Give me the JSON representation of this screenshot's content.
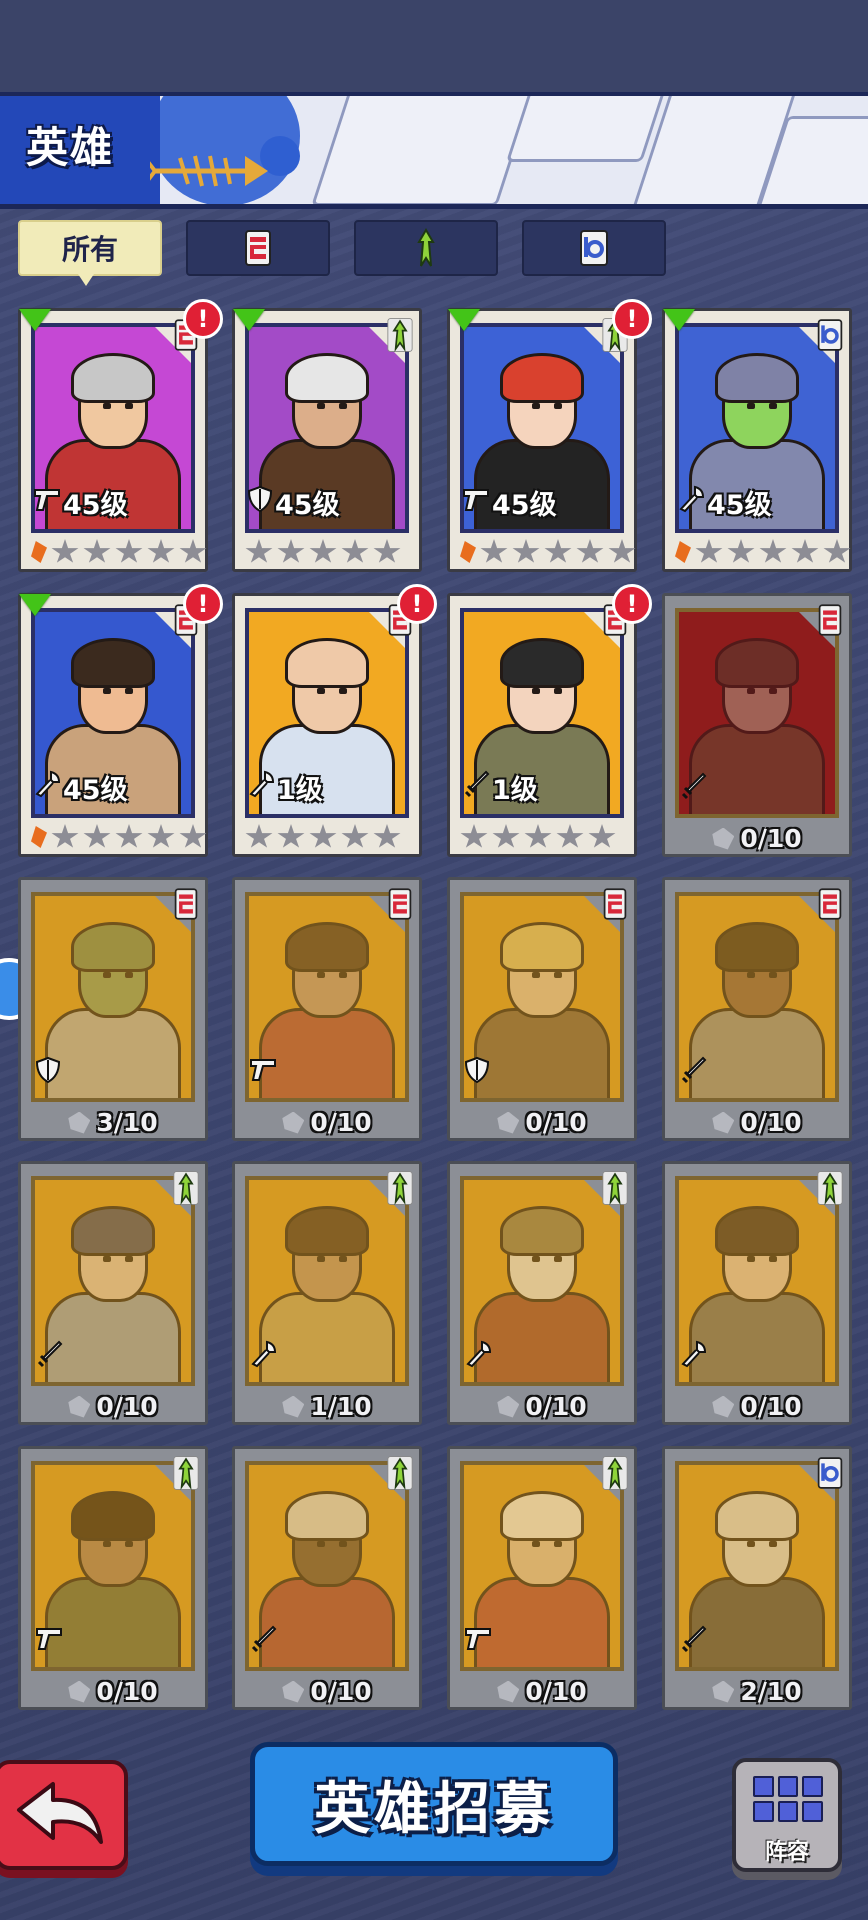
{
  "header": {
    "title": "英雄"
  },
  "tabs": [
    {
      "label": "所有",
      "icon": "all",
      "active": true
    },
    {
      "label": "",
      "icon": "tank-class-icon",
      "active": false
    },
    {
      "label": "",
      "icon": "agility-class-icon",
      "active": false
    },
    {
      "label": "",
      "icon": "tech-class-icon",
      "active": false
    }
  ],
  "colors": {
    "green_indicator": "#43c418",
    "alert": "#e02035",
    "accent_blue": "#2a8ce6",
    "back_red": "#e23245"
  },
  "heroes": [
    {
      "owned": true,
      "bg": "#c548d4",
      "class": "red",
      "role": "gun",
      "level": "45级",
      "new": true,
      "alert": true,
      "frag": true,
      "skin": "#f0c8a0",
      "hair": "#c7c7c7",
      "outfit": "#c03534"
    },
    {
      "owned": true,
      "bg": "#a34bc7",
      "class": "green",
      "role": "shield",
      "level": "45级",
      "new": true,
      "alert": false,
      "frag": false,
      "skin": "#dcae8a",
      "hair": "#e6e6e6",
      "outfit": "#5a3a24"
    },
    {
      "owned": true,
      "bg": "#3d62d6",
      "class": "green",
      "role": "gun",
      "level": "45级",
      "new": true,
      "alert": true,
      "frag": true,
      "skin": "#f5d4bd",
      "hair": "#d9412e",
      "outfit": "#232323"
    },
    {
      "owned": true,
      "bg": "#3f63d3",
      "class": "blue",
      "role": "wrench",
      "level": "45级",
      "new": true,
      "alert": false,
      "frag": true,
      "skin": "#8ed45d",
      "hair": "#7f82a6",
      "outfit": "#8288ad"
    },
    {
      "owned": true,
      "bg": "#3558cf",
      "class": "red",
      "role": "wrench",
      "level": "45级",
      "new": true,
      "alert": true,
      "frag": true,
      "skin": "#efbb92",
      "hair": "#3b2a1e",
      "outfit": "#c9a27b"
    },
    {
      "owned": true,
      "bg": "#f2a922",
      "class": "red",
      "role": "wrench",
      "level": "1级",
      "new": false,
      "alert": true,
      "frag": false,
      "skin": "#efc9a8",
      "hair": "#efc9a8",
      "outfit": "#d7e1ef"
    },
    {
      "owned": true,
      "bg": "#f2a922",
      "class": "red",
      "role": "sword",
      "level": "1级",
      "new": false,
      "alert": true,
      "frag": false,
      "skin": "#f3d4be",
      "hair": "#2a2a2a",
      "outfit": "#7a7a55"
    },
    {
      "owned": false,
      "bg": "#8f1c1c",
      "class": "red",
      "role": "sword",
      "shards": "0/10",
      "skin": "#b59a79",
      "hair": "#5a3d2a",
      "outfit": "#6e4a2a"
    },
    {
      "owned": false,
      "bg": "#d69a22",
      "class": "red",
      "role": "shield",
      "shards": "3/10",
      "skin": "#7da055",
      "hair": "#6b8c48",
      "outfit": "#b0b0b0"
    },
    {
      "owned": false,
      "bg": "#d69a22",
      "class": "red",
      "role": "gun",
      "shards": "0/10",
      "skin": "#c49473",
      "hair": "#4b3323",
      "outfit": "#c53d37"
    },
    {
      "owned": false,
      "bg": "#d69a22",
      "class": "red",
      "role": "shield",
      "shards": "0/10",
      "skin": "#e9c49a",
      "hair": "#e4c150",
      "outfit": "#7a5a3a"
    },
    {
      "owned": false,
      "bg": "#d69a22",
      "class": "red",
      "role": "sword",
      "shards": "0/10",
      "skin": "#8b5a3a",
      "hair": "#3a2a1a",
      "outfit": "#8c8c8c"
    },
    {
      "owned": false,
      "bg": "#d69a22",
      "class": "green",
      "role": "sword",
      "shards": "0/10",
      "skin": "#e6c6b0",
      "hair": "#404a78",
      "outfit": "#8aa1c4"
    },
    {
      "owned": false,
      "bg": "#d69a22",
      "class": "green",
      "role": "wrench",
      "shards": "1/10",
      "skin": "#c49060",
      "hair": "#4a3020",
      "outfit": "#c9a44a"
    },
    {
      "owned": false,
      "bg": "#d69a22",
      "class": "green",
      "role": "wrench",
      "shards": "0/10",
      "skin": "#e8e8e8",
      "hair": "#8a7a4a",
      "outfit": "#b03c28"
    },
    {
      "owned": false,
      "bg": "#d69a22",
      "class": "green",
      "role": "wrench",
      "shards": "0/10",
      "skin": "#e9c4aa",
      "hair": "#3a2a2a",
      "outfit": "#6a6a6a"
    },
    {
      "owned": false,
      "bg": "#d69a22",
      "class": "green",
      "role": "gun",
      "shards": "0/10",
      "skin": "#b07a52",
      "hair": "#2a1a10",
      "outfit": "#5a6a3a"
    },
    {
      "owned": false,
      "bg": "#d69a22",
      "class": "green",
      "role": "sword",
      "shards": "0/10",
      "skin": "#6a4a34",
      "hair": "#d8d8d8",
      "outfit": "#c03535"
    },
    {
      "owned": false,
      "bg": "#d69a22",
      "class": "green",
      "role": "gun",
      "shards": "0/10",
      "skin": "#e6c09a",
      "hair": "#eeeeee",
      "outfit": "#d23a30"
    },
    {
      "owned": false,
      "bg": "#d69a22",
      "class": "blue",
      "role": "sword",
      "shards": "2/10",
      "skin": "#dcdcdc",
      "hair": "#dcdcdc",
      "outfit": "#4a4a4a"
    }
  ],
  "bottom": {
    "back_icon": "back-arrow-icon",
    "recruit_label": "英雄招募",
    "lineup_label": "阵容",
    "lineup_icon": "grid-icon"
  }
}
